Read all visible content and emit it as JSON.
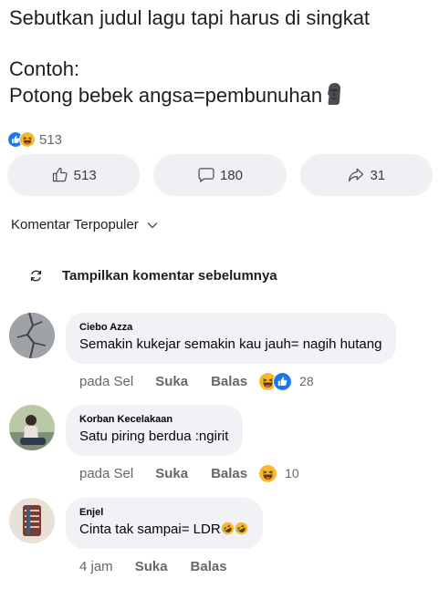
{
  "post": {
    "line1": "Sebutkan judul lagu tapi harus di singkat",
    "line2": "Contoh:",
    "line3": "Potong bebek angsa=pembunuhan",
    "moai_icon": "moai-emoji-icon"
  },
  "reactions": {
    "icons": [
      "like-icon",
      "haha-icon"
    ],
    "count": "513"
  },
  "actions": {
    "like_count": "513",
    "comment_count": "180",
    "share_count": "31"
  },
  "sort": {
    "label": "Komentar Terpopuler"
  },
  "show_previous": {
    "label": "Tampilkan komentar sebelumnya"
  },
  "comments": [
    {
      "author": "Ciebo Azza",
      "text": "Semakin kukejar semakin kau jauh= nagih hutang",
      "time": "pada Sel",
      "like_label": "Suka",
      "reply_label": "Balas",
      "reaction_icons": [
        "haha-icon",
        "like-icon"
      ],
      "reaction_count": "28"
    },
    {
      "author": "Korban Kecelakaan",
      "text": "Satu piring berdua :ngirit",
      "time": "pada Sel",
      "like_label": "Suka",
      "reply_label": "Balas",
      "reaction_icons": [
        "haha-icon"
      ],
      "reaction_count": "10"
    },
    {
      "author": "Enjel",
      "text": "Cinta tak sampai= LDR",
      "time": "4 jam",
      "like_label": "Suka",
      "reply_label": "Balas",
      "text_emojis": [
        "rofl-emoji-icon",
        "rofl-emoji-icon"
      ]
    }
  ],
  "colors": {
    "like_blue": "#1877f2",
    "haha_yellow": "#f7b928",
    "bubble_bg": "#f0f2f5",
    "button_bg": "#eef0f3",
    "meta_grey": "#65676b"
  }
}
